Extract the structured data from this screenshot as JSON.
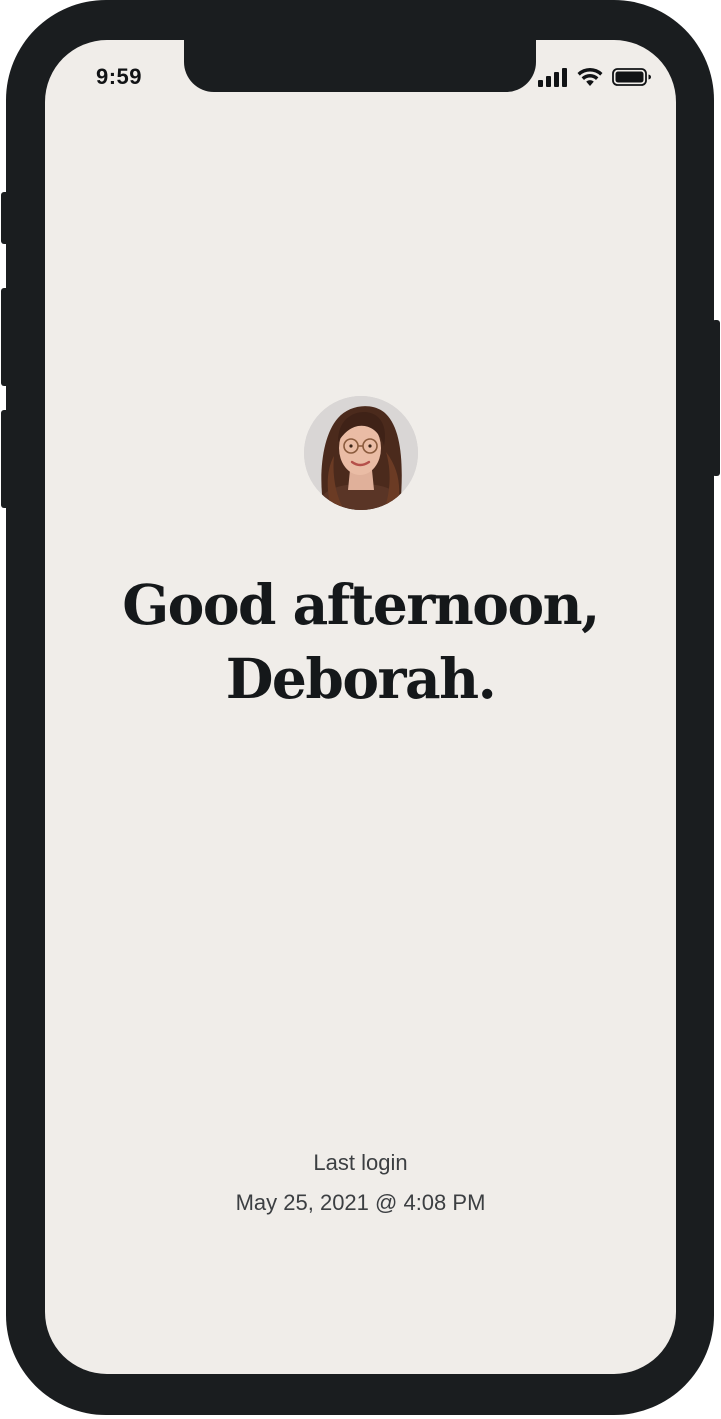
{
  "status_bar": {
    "time": "9:59",
    "icons": [
      "cellular-signal-icon",
      "wifi-icon",
      "battery-icon"
    ]
  },
  "profile": {
    "avatar": "avatar"
  },
  "greeting": {
    "line1": "Good afternoon,",
    "line2": "Deborah."
  },
  "last_login": {
    "label": "Last login",
    "value": "May 25, 2021 @ 4:08 PM"
  },
  "colors": {
    "screen_background": "#f0ede9",
    "device_frame": "#1a1d1f",
    "heading_text": "#15181a",
    "secondary_text": "#3c3f42"
  }
}
